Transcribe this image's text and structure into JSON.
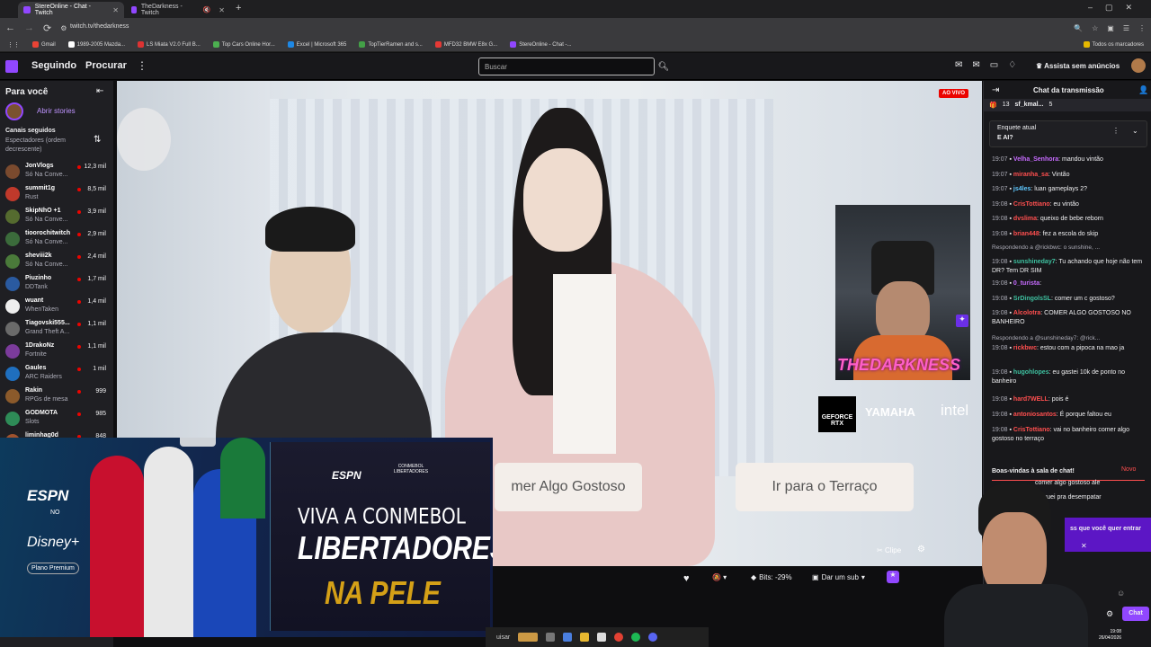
{
  "browser": {
    "tabs": [
      {
        "label": "StereOnline - Chat - Twitch"
      },
      {
        "label": "TheDarkness - Twitch"
      }
    ],
    "url": "twitch.tv/thedarkness",
    "bookmarks": [
      "Gmail",
      "1989-2005 Mazda...",
      "LS Miata V2.0 Full B...",
      "Top Cars Online Hor...",
      "Excel | Microsoft 365",
      "TopTierRamen and s...",
      "MFD32 BMW E8x G...",
      "StereOnline - Chat -..."
    ],
    "bookmarks_all": "Todos os marcadores"
  },
  "nav": {
    "following": "Seguindo",
    "browse": "Procurar",
    "search_placeholder": "Buscar",
    "prime": "Assista sem anúncios"
  },
  "sidebar": {
    "title": "Para você",
    "stories": "Abrir stories",
    "followed_title": "Canais seguidos",
    "followed_sub": "Espectadores (ordem decrescente)",
    "channels": [
      {
        "name": "JonVlogs",
        "game": "Só Na Conve...",
        "viewers": "12,3 mil",
        "color": "#7a4a2e"
      },
      {
        "name": "summit1g",
        "game": "Rust",
        "viewers": "8,5 mil",
        "color": "#c0392b"
      },
      {
        "name": "SkipNhO +1",
        "game": "Só Na Conve...",
        "viewers": "3,9 mil",
        "color": "#556b2f"
      },
      {
        "name": "tioorochitwitch",
        "game": "Só Na Conve...",
        "viewers": "2,9 mil",
        "color": "#3b6b3b"
      },
      {
        "name": "sheviii2k",
        "game": "Só Na Conve...",
        "viewers": "2,4 mil",
        "color": "#4a7a3a"
      },
      {
        "name": "Piuzinho",
        "game": "DDTank",
        "viewers": "1,7 mil",
        "color": "#2a5aa0"
      },
      {
        "name": "wuant",
        "game": "WhenTaken",
        "viewers": "1,4 mil",
        "color": "#eeeeee"
      },
      {
        "name": "Tiagovski555...",
        "game": "Grand Theft A...",
        "viewers": "1,1 mil",
        "color": "#6a6a6a"
      },
      {
        "name": "1DrakoNz",
        "game": "Fortnite",
        "viewers": "1,1 mil",
        "color": "#7b3b9b"
      },
      {
        "name": "Gaules",
        "game": "ARC Raiders",
        "viewers": "1 mil",
        "color": "#1f6fbf"
      },
      {
        "name": "Rakin",
        "game": "RPGs de mesa",
        "viewers": "999",
        "color": "#8b5a2b"
      },
      {
        "name": "GODMOTA",
        "game": "Slots",
        "viewers": "985",
        "color": "#2e8b57"
      },
      {
        "name": "liminhag0d",
        "game": "",
        "viewers": "848",
        "color": "#a0522d"
      }
    ]
  },
  "video": {
    "live_badge": "AO VIVO",
    "choice1": "mer Algo Gostoso",
    "choice2": "Ir para o Terraço",
    "webcam_name": "THEDARKNESS",
    "sponsors": [
      "GEFORCE RTX",
      "YAMAHA",
      "intel"
    ]
  },
  "controls": {
    "clip": "Clipe",
    "bits": "Bits: -29%",
    "sub": "Dar um sub"
  },
  "chat": {
    "title": "Chat da transmissão",
    "gift_count": "13",
    "gift_user": "sf_kmal...",
    "gift_count2": "5",
    "poll_label": "Enquete atual",
    "poll_question": "E AI?",
    "messages": [
      {
        "time": "19:07",
        "user": "Velha_Senhora",
        "color": "#c76bff",
        "text": "mandou vintão"
      },
      {
        "time": "19:07",
        "user": "miranha_sa",
        "color": "#ff4f4f",
        "text": "Vintão"
      },
      {
        "time": "19:07",
        "user": "js4les",
        "color": "#5ec8ff",
        "text": "luan gameplays 2?"
      },
      {
        "time": "19:08",
        "user": "CrisTottiano",
        "color": "#ff4f4f",
        "text": "eu vintão"
      },
      {
        "time": "19:08",
        "user": "dvslima",
        "color": "#ff4f4f",
        "text": "queixo de bebe reborn"
      },
      {
        "time": "19:08",
        "user": "brian448",
        "color": "#ff4f4f",
        "text": "fez a escola do skip"
      }
    ],
    "reply1": "Respondendo a @rickbwc: o sunshine, ...",
    "msg_sunshine": {
      "time": "19:08",
      "user": "sunshineday7",
      "color": "#3ec1a0",
      "text": "Tu achando que hoje não tem DR? Tem DR SIM"
    },
    "msg_oturista": {
      "time": "19:08",
      "user": "0_turista",
      "color": "#c76bff",
      "text": ""
    },
    "msg_srdingo": {
      "time": "19:08",
      "user": "SrDingolsSL",
      "color": "#3ec1a0",
      "text": "comer um c gostoso?"
    },
    "msg_alcolotra": {
      "time": "19:08",
      "user": "Alcolotra",
      "color": "#ff4f4f",
      "text": "COMER ALGO GOSTOSO NO BANHEIRO"
    },
    "reply2": "Respondendo a @sunshineday7: @rick...",
    "msg_rickbwc": {
      "time": "19:08",
      "user": "rickbwc",
      "color": "#ff4f4f",
      "text": "estou com a pipoca na mao ja"
    },
    "msg_hugo": {
      "time": "19:08",
      "user": "hugohlopes",
      "color": "#3ec1a0",
      "text": "eu gastei 10k de ponto no banheiro"
    },
    "msg_hard": {
      "time": "19:08",
      "user": "hard7WELL",
      "color": "#ff4f4f",
      "text": "pois é"
    },
    "msg_antonio": {
      "time": "19:08",
      "user": "antoniosantos",
      "color": "#ff4f4f",
      "text": "É porque faltou eu"
    },
    "msg_cris2": {
      "time": "19:08",
      "user": "CrisTottiano",
      "color": "#ff4f4f",
      "text": "vai no banheiro comer algo gostoso no terraço"
    },
    "welcome": "Boas-vindas à sala de chat!",
    "new_label": "Novo",
    "partial1": "comer algo gostoso ale",
    "partial2": "ch  guei pra desempatar",
    "prediction": "ss que você quer entrar",
    "send": "Chat"
  },
  "ad": {
    "brand": "ESPN",
    "no": "NO",
    "disney": "Disney+",
    "plan": "Plano Premium",
    "line1": "VIVA A CONMEBOL",
    "line2": "LIBERTADORES",
    "line3": "NA PELE",
    "conmebol": "CONMEBOL LIBERTADORES"
  },
  "taskbar": {
    "search_partial": "uisar",
    "clock_time": "19:08",
    "clock_date": "26/04/2026"
  }
}
